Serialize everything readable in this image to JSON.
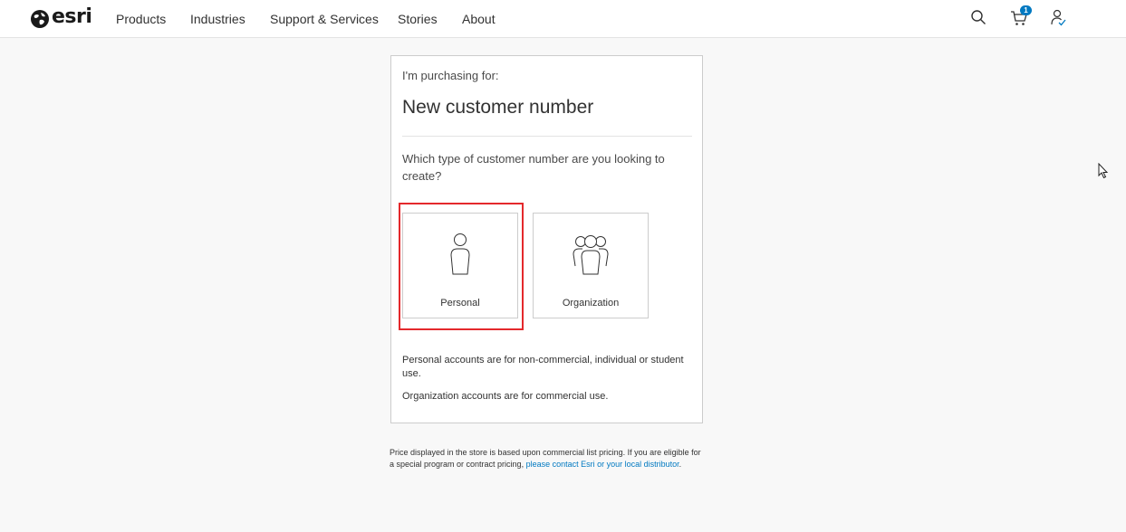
{
  "brand": {
    "name": "esri"
  },
  "nav": {
    "items": [
      "Products",
      "Industries",
      "Support & Services",
      "Stories",
      "About"
    ],
    "cart_count": "1"
  },
  "card": {
    "eyebrow": "I'm purchasing for:",
    "headline": "New customer number",
    "question": "Which type of customer number are you looking to create?",
    "options": [
      {
        "label": "Personal",
        "icon": "person-icon",
        "selected": true
      },
      {
        "label": "Organization",
        "icon": "group-icon",
        "selected": false
      }
    ],
    "note_personal": "Personal accounts are for non-commercial, individual or student use.",
    "note_org": "Organization accounts are for commercial use."
  },
  "disclaimer": {
    "text": "Price displayed in the store is based upon commercial list pricing. If you are eligible for a special program or contract pricing, ",
    "link": "please contact Esri or your local distributor",
    "end": "."
  },
  "colors": {
    "accent": "#0079c1",
    "highlight": "#e4292c"
  }
}
